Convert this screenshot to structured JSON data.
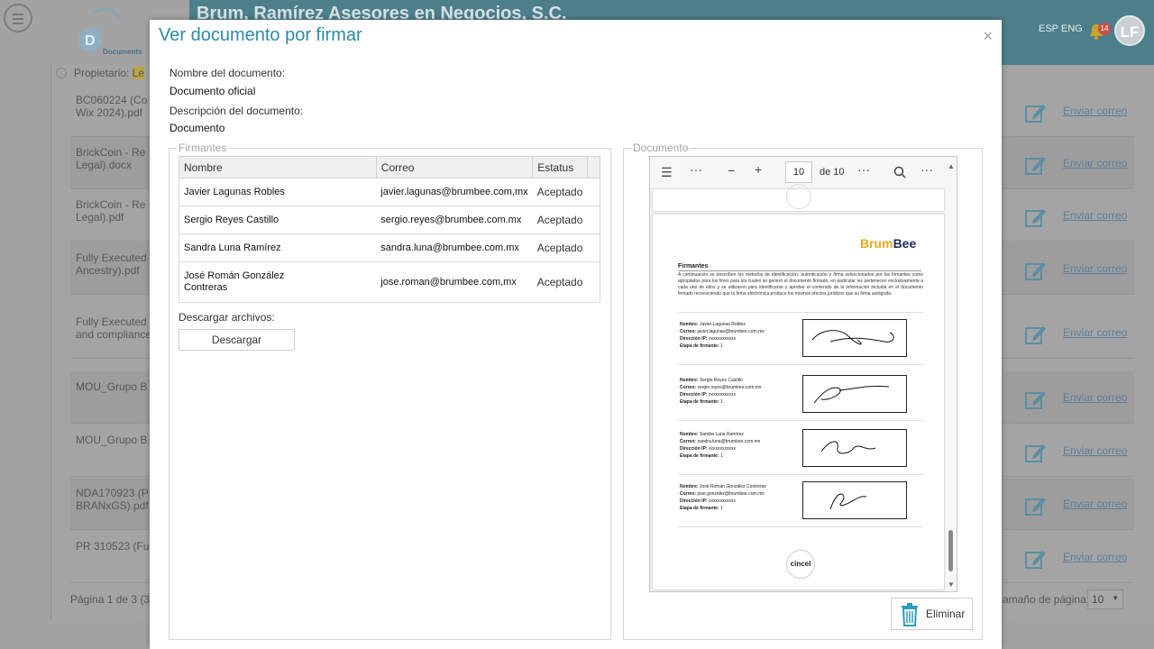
{
  "background": {
    "company_name": "Brum, Ramírez Asesores en Negocios, S.C.",
    "lang_switch": "ESP ENG",
    "notification_count": "14",
    "avatar_initials": "LF",
    "logo_text": "Documents",
    "owner_label": "Propietario:",
    "owner_value": "Le",
    "rows": [
      {
        "name": "BC060224 (Co\nWix 2024).pdf",
        "action": "Enviar correo"
      },
      {
        "name": "BrickCoin - Re\nLegal).docx",
        "action": "Enviar correo"
      },
      {
        "name": "BrickCoin - Re\nLegal).pdf",
        "action": "Enviar correo"
      },
      {
        "name": "Fully Executed\nAncestry).pdf",
        "action": "Enviar correo"
      },
      {
        "name": "Fully Executed\nand compliance",
        "action": "Enviar correo"
      },
      {
        "name": "MOU_Grupo B",
        "action": "Enviar correo"
      },
      {
        "name": "MOU_Grupo B",
        "action": "Enviar correo"
      },
      {
        "name": "NDA170923 (P\nBRANxGS).pdf",
        "action": "Enviar correo"
      },
      {
        "name": "PR 310523 (Fu",
        "action": "Enviar correo"
      }
    ],
    "pager": "Página 1 de 3 (3",
    "page_size_label": "amaño de página:",
    "page_size_value": "10"
  },
  "modal": {
    "title": "Ver documento por firmar",
    "close": "×",
    "doc_name_label": "Nombre del documento:",
    "doc_name_value": "Documento oficial",
    "doc_desc_label": "Descripción del documento:",
    "doc_desc_value": "Documento",
    "signers_legend": "Firmantes",
    "columns": [
      "Nombre",
      "Correo",
      "Estatus"
    ],
    "signers": [
      {
        "name": "Javier Lagunas Robles",
        "email": "javier.lagunas@brumbee.com,mx",
        "status": "Aceptado"
      },
      {
        "name": "Sergio Reyes Castillo",
        "email": "sergio.reyes@brumbee.com.mx",
        "status": "Aceptado"
      },
      {
        "name": "Sandra Luna Ramírez",
        "email": "sandra.luna@brumbee.com.mx",
        "status": "Aceptado"
      },
      {
        "name": "José Román González\nContreras",
        "email": "jose.roman@brumbee.com,mx",
        "status": "Aceptado"
      }
    ],
    "download_label": "Descargar archivos:",
    "download_button": "Descargar",
    "document_legend": "Documento",
    "delete_button": "Eliminar"
  },
  "viewer": {
    "page_current": "10",
    "page_total": "de 10",
    "brand_part1": "Brum",
    "brand_part2": "Bee",
    "heading": "Firmantes",
    "intro": "A continuación se describen los métodos de identificación, autenticación y firma seleccionados por los firmantes como apropiados para los fines para los cuales se generó el documento firmado, en particular les pertenecen exclusivamente a cada uno de ellos y se utilizaron para identificarse y aprobar el contenido de la información incluida en el documento firmado reconociendo que la firma electrónica produce los mismos efectos jurídicos que su firma autógrafa.",
    "field_labels": {
      "name": "Nombre:",
      "email": "Correo:",
      "ip": "Dirección IP:",
      "stage": "Etapa de firmante:"
    },
    "signature_blocks": [
      {
        "name": "Javier Lagunas Robles",
        "email": "javier.lagunas@brumbee.com.mx",
        "ip": "xxxxxxxxxxxx",
        "stage": "1"
      },
      {
        "name": "Sergio Reyes Castillo",
        "email": "sergio.reyes@brumbee.com.mx",
        "ip": "xxxxxxxxxxxx",
        "stage": "1"
      },
      {
        "name": "Sandra Luna Ramírez",
        "email": "sandra.luna@brumbee.com.mx",
        "ip": "xxxxxxxxxxxx",
        "stage": "1"
      },
      {
        "name": "José Román González Contreras",
        "email": "jose.gonzalez@brumbee.com.mx",
        "ip": "xxxxxxxxxxxx",
        "stage": "1"
      }
    ],
    "seal": "cincel"
  },
  "colors": {
    "accent": "#2a8aa6",
    "topbar": "#4d7f8a",
    "brand_yellow": "#f0a820",
    "brand_navy": "#1f2a5b"
  }
}
